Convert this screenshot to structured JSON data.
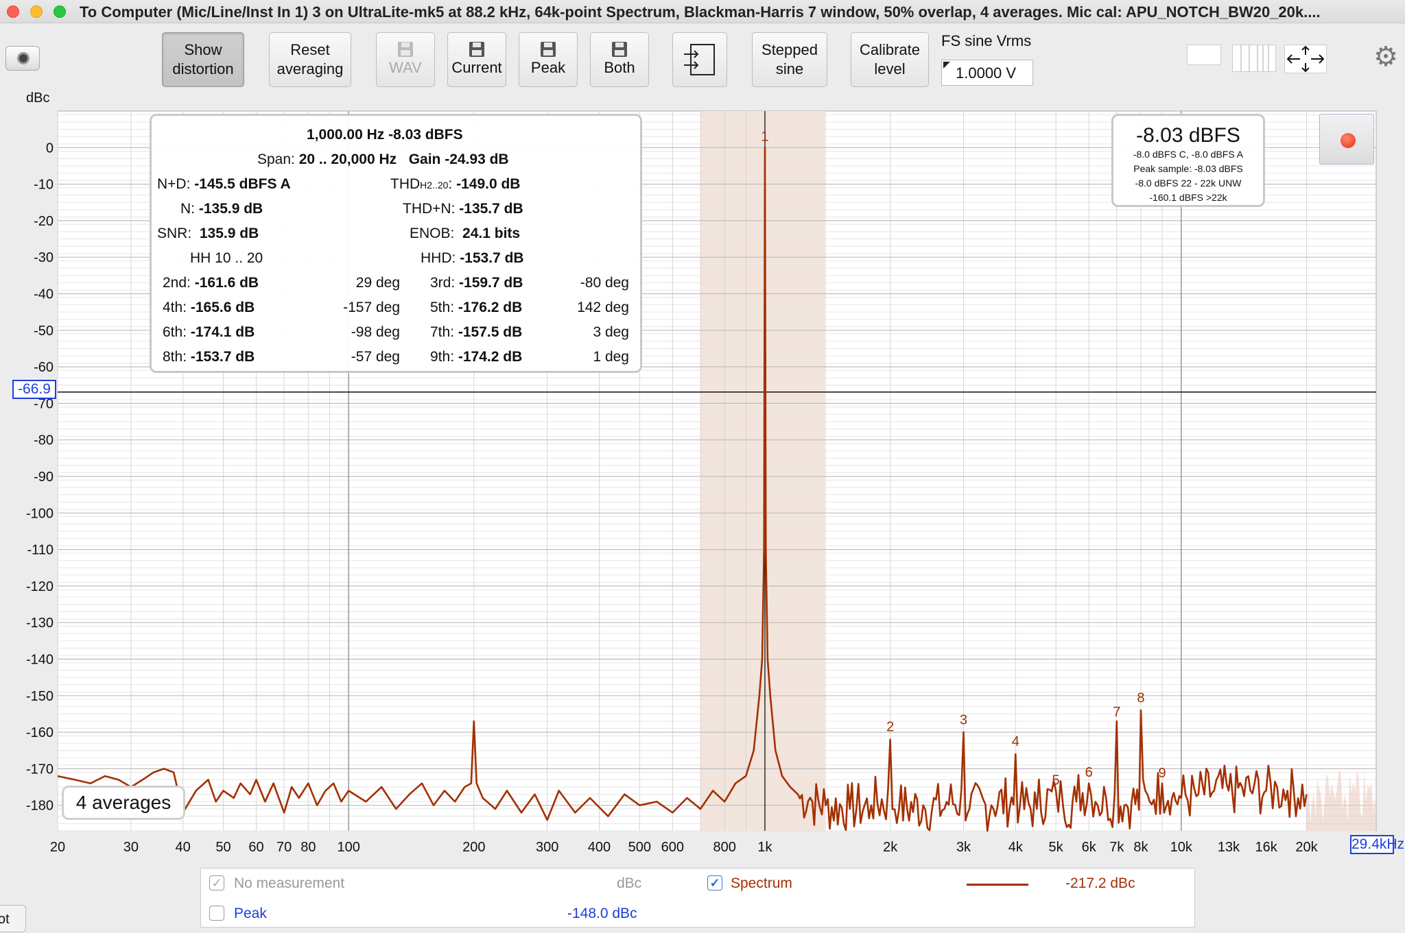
{
  "window": {
    "title": "To Computer (Mic/Line/Inst In 1) 3 on UltraLite-mk5 at 88.2 kHz, 64k-point Spectrum, Blackman-Harris 7 window, 50% overlap, 4 averages. Mic cal: APU_NOTCH_BW20_20k...."
  },
  "toolbar": {
    "show_distortion": [
      "Show",
      "distortion"
    ],
    "reset_averaging": [
      "Reset",
      "averaging"
    ],
    "wav": "WAV",
    "current": "Current",
    "peak": "Peak",
    "both": "Both",
    "stepped_sine": [
      "Stepped",
      "sine"
    ],
    "calibrate_level": [
      "Calibrate",
      "level"
    ],
    "fs_label": "FS sine Vrms",
    "fs_value": "1.0000 V"
  },
  "chart_header": {
    "y_unit": "dBc"
  },
  "distortion_panel": {
    "fundamental": "1,000.00 Hz  -8.03 dBFS",
    "span_label": "Span:",
    "span_value": "20 .. 20,000 Hz",
    "gain_label": "Gain",
    "gain_value": "-24.93 dB",
    "nd_label": "N+D:",
    "nd_value": "-145.5 dBFS A",
    "thd_label": "THD",
    "thd_sub": "H2..20",
    "thd_value": "-149.0 dB",
    "n_label": "N:",
    "n_value": "-135.9 dB",
    "thdn_label": "THD+N:",
    "thdn_value": "-135.7 dB",
    "snr_label": "SNR:",
    "snr_value": "135.9 dB",
    "enob_label": "ENOB:",
    "enob_value": "24.1 bits",
    "hh_label": "HH 10 .. 20",
    "hhd_label": "HHD:",
    "hhd_value": "-153.7 dB",
    "harmonics": [
      {
        "l1": "2nd:",
        "v1": "-161.6 dB",
        "p1": "29 deg",
        "l2": "3rd:",
        "v2": "-159.7 dB",
        "p2": "-80 deg"
      },
      {
        "l1": "4th:",
        "v1": "-165.6 dB",
        "p1": "-157 deg",
        "l2": "5th:",
        "v2": "-176.2 dB",
        "p2": "142 deg"
      },
      {
        "l1": "6th:",
        "v1": "-174.1 dB",
        "p1": "-98 deg",
        "l2": "7th:",
        "v2": "-157.5 dB",
        "p2": "3 deg"
      },
      {
        "l1": "8th:",
        "v1": "-153.7 dB",
        "p1": "-57 deg",
        "l2": "9th:",
        "v2": "-174.2 dB",
        "p2": "1 deg"
      }
    ]
  },
  "level_panel": {
    "main": "-8.03 dBFS",
    "lines": [
      "-8.0 dBFS C, -8.0 dBFS A",
      "Peak sample: -8.03 dBFS",
      "-8.0 dBFS 22 - 22k UNW",
      "-160.1 dBFS >22k"
    ]
  },
  "averages_badge": "4 averages",
  "cursor": {
    "y_readout": "-66.9",
    "x_readout": "29.4kHz"
  },
  "legend": {
    "no_measurement": "No measurement",
    "no_measurement_unit": "dBc",
    "spectrum": "Spectrum",
    "spectrum_value": "-217.2 dBc",
    "peak": "Peak",
    "peak_value": "-148.0 dBc"
  },
  "bottom_tab": "ot",
  "colors": {
    "trace": "#a33000",
    "highlight_band": "#f3e4dc",
    "cursor": "#1e3ce0",
    "harmonic_label": "#a33000"
  },
  "chart_data": {
    "type": "line",
    "x_scale": "log",
    "y_unit": "dBc",
    "xlim": [
      20,
      29400
    ],
    "ylim": [
      -187,
      10
    ],
    "y_ticks": [
      0,
      -10,
      -20,
      -30,
      -40,
      -50,
      -60,
      -70,
      -80,
      -90,
      -100,
      -110,
      -120,
      -130,
      -140,
      -150,
      -160,
      -170,
      -180
    ],
    "x_ticks": [
      {
        "v": 20,
        "label": "20"
      },
      {
        "v": 30,
        "label": "30"
      },
      {
        "v": 40,
        "label": "40"
      },
      {
        "v": 50,
        "label": "50"
      },
      {
        "v": 60,
        "label": "60"
      },
      {
        "v": 70,
        "label": "70"
      },
      {
        "v": 80,
        "label": "80"
      },
      {
        "v": 100,
        "label": "100"
      },
      {
        "v": 200,
        "label": "200"
      },
      {
        "v": 300,
        "label": "300"
      },
      {
        "v": 400,
        "label": "400"
      },
      {
        "v": 500,
        "label": "500"
      },
      {
        "v": 600,
        "label": "600"
      },
      {
        "v": 800,
        "label": "800"
      },
      {
        "v": 1000,
        "label": "1k"
      },
      {
        "v": 2000,
        "label": "2k"
      },
      {
        "v": 3000,
        "label": "3k"
      },
      {
        "v": 4000,
        "label": "4k"
      },
      {
        "v": 5000,
        "label": "5k"
      },
      {
        "v": 6000,
        "label": "6k"
      },
      {
        "v": 7000,
        "label": "7k"
      },
      {
        "v": 8000,
        "label": "8k"
      },
      {
        "v": 10000,
        "label": "10k"
      },
      {
        "v": 13000,
        "label": "13k"
      },
      {
        "v": 16000,
        "label": "16k"
      },
      {
        "v": 20000,
        "label": "20k"
      }
    ],
    "highlight_band": [
      700,
      1400
    ],
    "fundamental": {
      "freq": 1000,
      "level": 0
    },
    "cursor_level": -66.9,
    "harmonics": [
      {
        "label": "1",
        "freq": 1000,
        "level": 0
      },
      {
        "label": "2",
        "freq": 2000,
        "level": -161.6
      },
      {
        "label": "3",
        "freq": 3000,
        "level": -159.7
      },
      {
        "label": "4",
        "freq": 4000,
        "level": -165.6
      },
      {
        "label": "5",
        "freq": 5000,
        "level": -176.2
      },
      {
        "label": "6",
        "freq": 6000,
        "level": -174.1
      },
      {
        "label": "7",
        "freq": 7000,
        "level": -157.5
      },
      {
        "label": "8",
        "freq": 8000,
        "level": -153.7
      },
      {
        "label": "9",
        "freq": 9000,
        "level": -174.2
      }
    ],
    "series": [
      {
        "name": "Spectrum",
        "points": [
          [
            20,
            -172
          ],
          [
            22,
            -173
          ],
          [
            24,
            -174
          ],
          [
            26,
            -172
          ],
          [
            28,
            -173
          ],
          [
            30,
            -175
          ],
          [
            32,
            -173
          ],
          [
            34,
            -171
          ],
          [
            36,
            -170
          ],
          [
            38,
            -171
          ],
          [
            40,
            -182
          ],
          [
            43,
            -176
          ],
          [
            46,
            -173
          ],
          [
            48,
            -179
          ],
          [
            50,
            -176
          ],
          [
            53,
            -178
          ],
          [
            55,
            -174
          ],
          [
            58,
            -177
          ],
          [
            60,
            -173
          ],
          [
            63,
            -179
          ],
          [
            66,
            -174
          ],
          [
            70,
            -182
          ],
          [
            73,
            -175
          ],
          [
            76,
            -178
          ],
          [
            80,
            -174
          ],
          [
            84,
            -180
          ],
          [
            88,
            -176
          ],
          [
            92,
            -174
          ],
          [
            96,
            -179
          ],
          [
            100,
            -176
          ],
          [
            110,
            -179
          ],
          [
            120,
            -175
          ],
          [
            130,
            -181
          ],
          [
            140,
            -177
          ],
          [
            150,
            -174
          ],
          [
            160,
            -180
          ],
          [
            170,
            -176
          ],
          [
            180,
            -179
          ],
          [
            190,
            -175
          ],
          [
            197,
            -174
          ],
          [
            200,
            -157
          ],
          [
            203,
            -174
          ],
          [
            210,
            -178
          ],
          [
            225,
            -181
          ],
          [
            240,
            -176
          ],
          [
            260,
            -182
          ],
          [
            280,
            -177
          ],
          [
            300,
            -184
          ],
          [
            320,
            -176
          ],
          [
            350,
            -182
          ],
          [
            380,
            -178
          ],
          [
            420,
            -183
          ],
          [
            460,
            -177
          ],
          [
            500,
            -180
          ],
          [
            550,
            -179
          ],
          [
            600,
            -182
          ],
          [
            650,
            -178
          ],
          [
            700,
            -181
          ],
          [
            750,
            -176
          ],
          [
            800,
            -179
          ],
          [
            850,
            -174
          ],
          [
            900,
            -172
          ],
          [
            940,
            -165
          ],
          [
            970,
            -150
          ],
          [
            985,
            -140
          ],
          [
            995,
            -110
          ],
          [
            1000,
            0
          ],
          [
            1005,
            -110
          ],
          [
            1015,
            -140
          ],
          [
            1030,
            -150
          ],
          [
            1060,
            -165
          ],
          [
            1100,
            -172
          ],
          [
            1150,
            -175
          ],
          [
            1200,
            -177
          ],
          [
            1300,
            -179
          ],
          [
            1400,
            -180
          ],
          [
            1600,
            -181
          ],
          [
            1800,
            -180
          ],
          [
            2000,
            -162
          ],
          [
            2100,
            -181
          ],
          [
            2400,
            -180
          ],
          [
            2700,
            -181
          ],
          [
            3000,
            -160
          ],
          [
            3100,
            -181
          ],
          [
            3500,
            -180
          ],
          [
            4000,
            -166
          ],
          [
            4100,
            -180
          ],
          [
            4500,
            -181
          ],
          [
            5000,
            -176
          ],
          [
            5200,
            -180
          ],
          [
            5600,
            -179
          ],
          [
            6000,
            -174
          ],
          [
            6300,
            -180
          ],
          [
            6600,
            -178
          ],
          [
            7000,
            -157
          ],
          [
            7300,
            -180
          ],
          [
            7600,
            -179
          ],
          [
            8000,
            -154
          ],
          [
            8400,
            -179
          ],
          [
            9000,
            -174
          ],
          [
            9500,
            -178
          ],
          [
            10000,
            -178
          ],
          [
            11000,
            -177
          ],
          [
            12000,
            -176
          ],
          [
            13000,
            -176
          ],
          [
            14000,
            -175
          ],
          [
            15000,
            -174
          ],
          [
            16000,
            -176
          ],
          [
            17000,
            -175
          ],
          [
            18000,
            -176
          ],
          [
            20000,
            -177
          ]
        ]
      }
    ]
  }
}
